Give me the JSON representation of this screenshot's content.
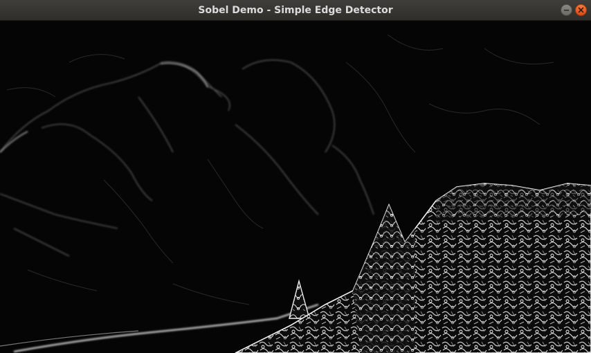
{
  "window": {
    "title": "Sobel Demo - Simple Edge Detector",
    "controls": {
      "minimize_icon": "minimize-icon",
      "close_icon": "close-icon"
    }
  },
  "image_view": {
    "content": "sobel-edge-magnitude-output"
  },
  "colors": {
    "titlebar": "#3a3935",
    "title_text": "#dcdcdc",
    "close_button": "#e95420",
    "background": "#050505",
    "edge": "#e6e6e6"
  }
}
